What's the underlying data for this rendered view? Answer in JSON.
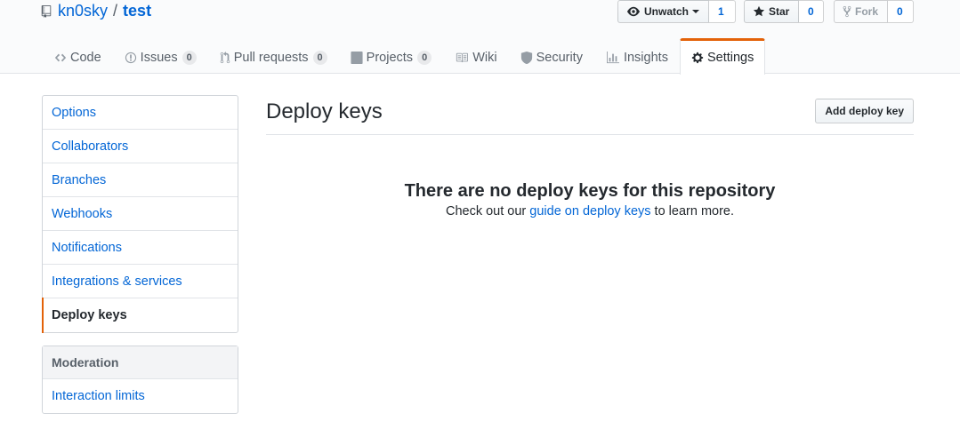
{
  "repo": {
    "owner": "kn0sky",
    "separator": "/",
    "name": "test"
  },
  "actions": {
    "watch": {
      "label": "Unwatch",
      "count": "1"
    },
    "star": {
      "label": "Star",
      "count": "0"
    },
    "fork": {
      "label": "Fork",
      "count": "0"
    }
  },
  "tabs": [
    {
      "label": "Code",
      "icon": "code-icon"
    },
    {
      "label": "Issues",
      "icon": "issue-icon",
      "counter": "0"
    },
    {
      "label": "Pull requests",
      "icon": "pull-request-icon",
      "counter": "0"
    },
    {
      "label": "Projects",
      "icon": "project-icon",
      "counter": "0"
    },
    {
      "label": "Wiki",
      "icon": "book-icon"
    },
    {
      "label": "Security",
      "icon": "shield-icon"
    },
    {
      "label": "Insights",
      "icon": "graph-icon"
    },
    {
      "label": "Settings",
      "icon": "gear-icon",
      "selected": true
    }
  ],
  "sidebar": {
    "items": [
      {
        "label": "Options"
      },
      {
        "label": "Collaborators"
      },
      {
        "label": "Branches"
      },
      {
        "label": "Webhooks"
      },
      {
        "label": "Notifications"
      },
      {
        "label": "Integrations & services"
      },
      {
        "label": "Deploy keys",
        "selected": true
      }
    ],
    "moderation": {
      "heading": "Moderation",
      "items": [
        {
          "label": "Interaction limits"
        }
      ]
    }
  },
  "main": {
    "title": "Deploy keys",
    "add_button": "Add deploy key",
    "blankslate": {
      "heading": "There are no deploy keys for this repository",
      "text_before": "Check out our ",
      "link": "guide on deploy keys",
      "text_after": " to learn more."
    }
  },
  "colors": {
    "link": "#0366d6",
    "accent": "#e36209",
    "text": "#24292e",
    "muted": "#586069"
  }
}
